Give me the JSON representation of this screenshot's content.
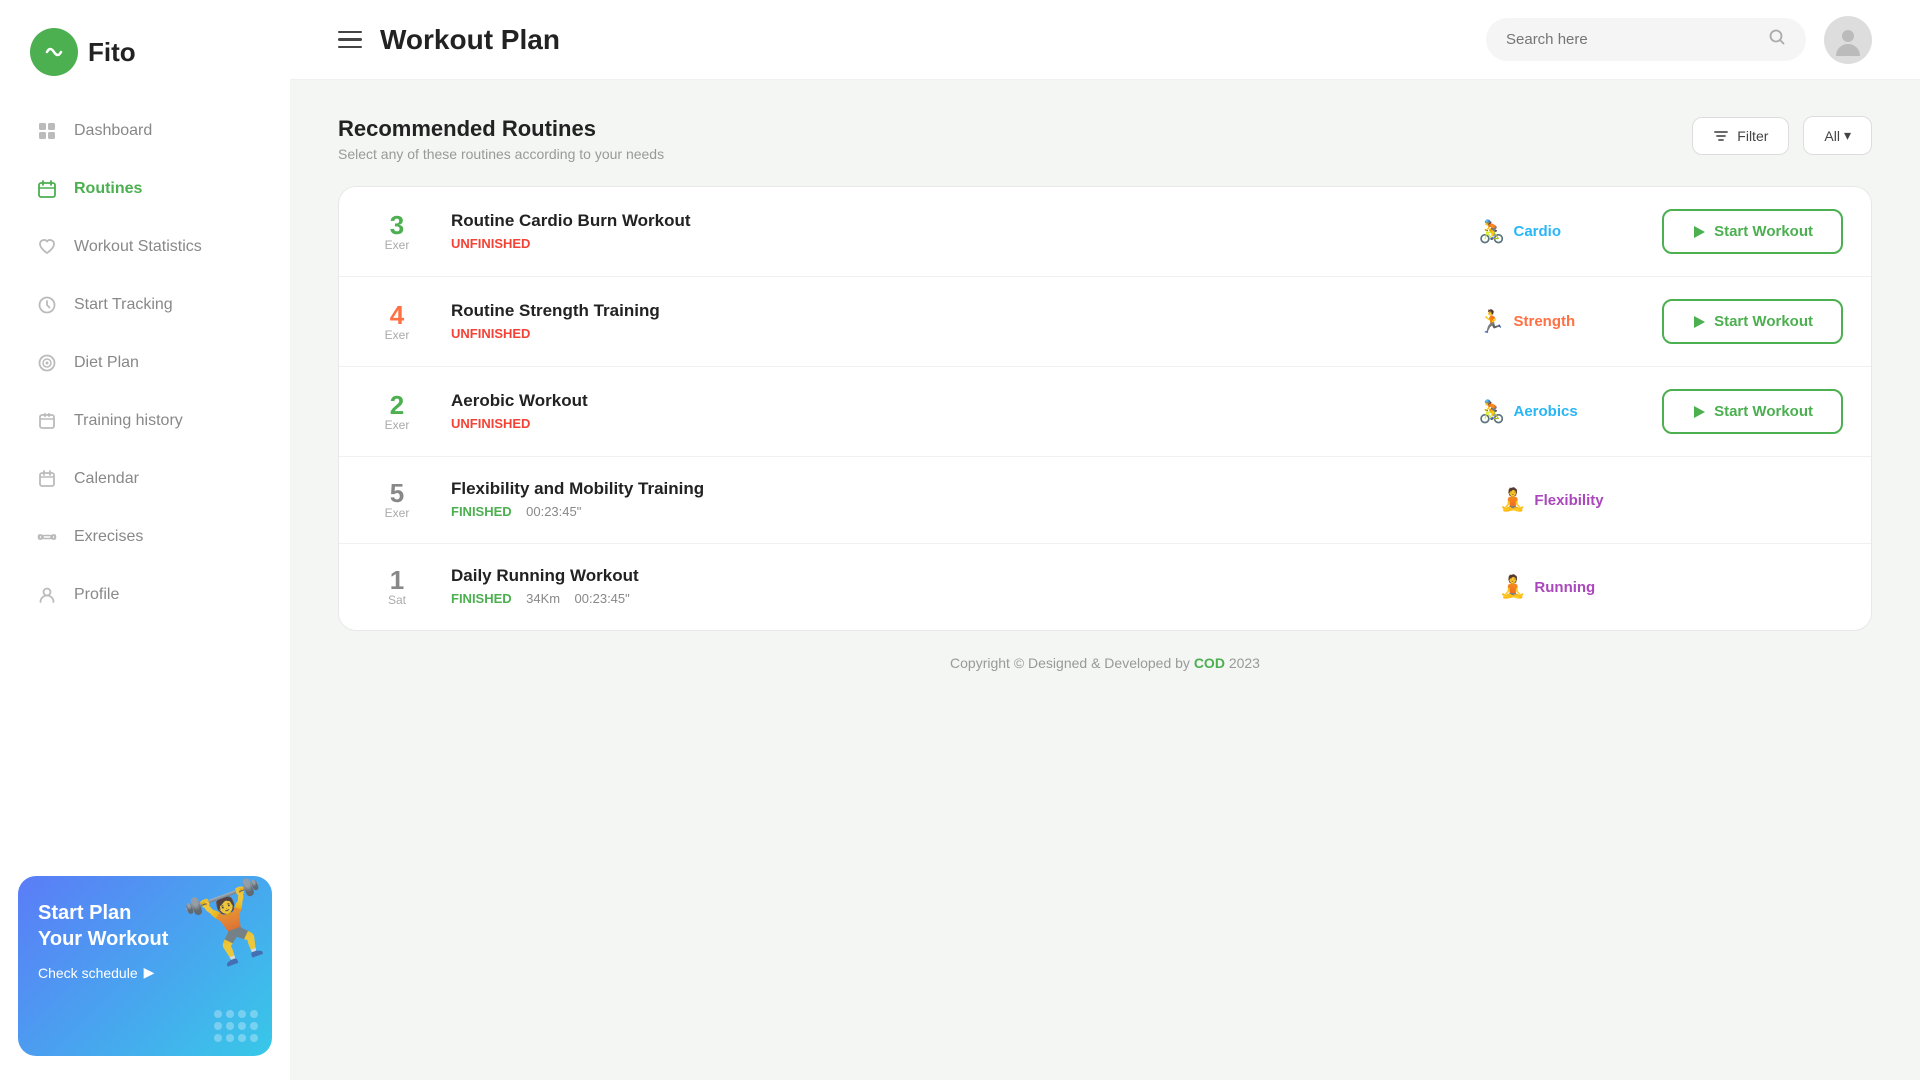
{
  "app": {
    "logo_text": "Fito",
    "page_title": "Workout Plan"
  },
  "sidebar": {
    "nav_items": [
      {
        "id": "dashboard",
        "label": "Dashboard",
        "icon": "grid-icon",
        "active": false
      },
      {
        "id": "routines",
        "label": "Routines",
        "icon": "calendar-icon",
        "active": true
      },
      {
        "id": "workout-statistics",
        "label": "Workout Statistics",
        "icon": "heart-icon",
        "active": false
      },
      {
        "id": "start-tracking",
        "label": "Start Tracking",
        "icon": "clock-icon",
        "active": false
      },
      {
        "id": "diet-plan",
        "label": "Diet Plan",
        "icon": "target-icon",
        "active": false
      },
      {
        "id": "training-history",
        "label": "Training history",
        "icon": "history-icon",
        "active": false
      },
      {
        "id": "calendar",
        "label": "Calendar",
        "icon": "calendar2-icon",
        "active": false
      },
      {
        "id": "exercises",
        "label": "Exrecises",
        "icon": "exercise-icon",
        "active": false
      },
      {
        "id": "profile",
        "label": "Profile",
        "icon": "profile-icon",
        "active": false
      }
    ],
    "promo": {
      "title": "Start Plan Your Workout",
      "link_text": "Check schedule",
      "dumbbell_emoji": "🏋️"
    }
  },
  "header": {
    "search_placeholder": "Search here"
  },
  "section": {
    "title": "Recommended Routines",
    "subtitle": "Select any of these routines according to your needs",
    "filter_label": "Filter",
    "all_label": "All"
  },
  "routines": [
    {
      "count": "3",
      "count_label": "Exer",
      "count_color": "green",
      "name": "Routine Cardio Burn Workout",
      "status": "UNFINISHED",
      "status_type": "unfinished",
      "extra": "",
      "type_label": "Cardio",
      "type_color": "cardio",
      "type_icon": "🚴",
      "has_start_btn": true
    },
    {
      "count": "4",
      "count_label": "Exer",
      "count_color": "orange",
      "name": "Routine Strength Training",
      "status": "UNFINISHED",
      "status_type": "unfinished",
      "extra": "",
      "type_label": "Strength",
      "type_color": "strength",
      "type_icon": "🏃",
      "has_start_btn": true
    },
    {
      "count": "2",
      "count_label": "Exer",
      "count_color": "green",
      "name": "Aerobic Workout",
      "status": "UNFINISHED",
      "status_type": "unfinished",
      "extra": "",
      "type_label": "Aerobics",
      "type_color": "aerobics",
      "type_icon": "🚴",
      "has_start_btn": true
    },
    {
      "count": "5",
      "count_label": "Exer",
      "count_color": "gray",
      "name": "Flexibility and Mobility Training",
      "status": "FINISHED",
      "status_type": "finished",
      "extra": "00:23:45\"",
      "type_label": "Flexibility",
      "type_color": "flexibility",
      "type_icon": "🧘",
      "has_start_btn": false
    },
    {
      "count": "1",
      "count_label": "Sat",
      "count_color": "gray",
      "name": "Daily Running Workout",
      "status": "FINISHED",
      "status_type": "finished",
      "extra": "34Km   00:23:45\"",
      "type_label": "Running",
      "type_color": "running",
      "type_icon": "🧘",
      "has_start_btn": false
    }
  ],
  "footer": {
    "text": "Copyright © Designed & Developed by",
    "brand": "COD",
    "year": "2023"
  },
  "buttons": {
    "start_workout": "Start Workout"
  }
}
